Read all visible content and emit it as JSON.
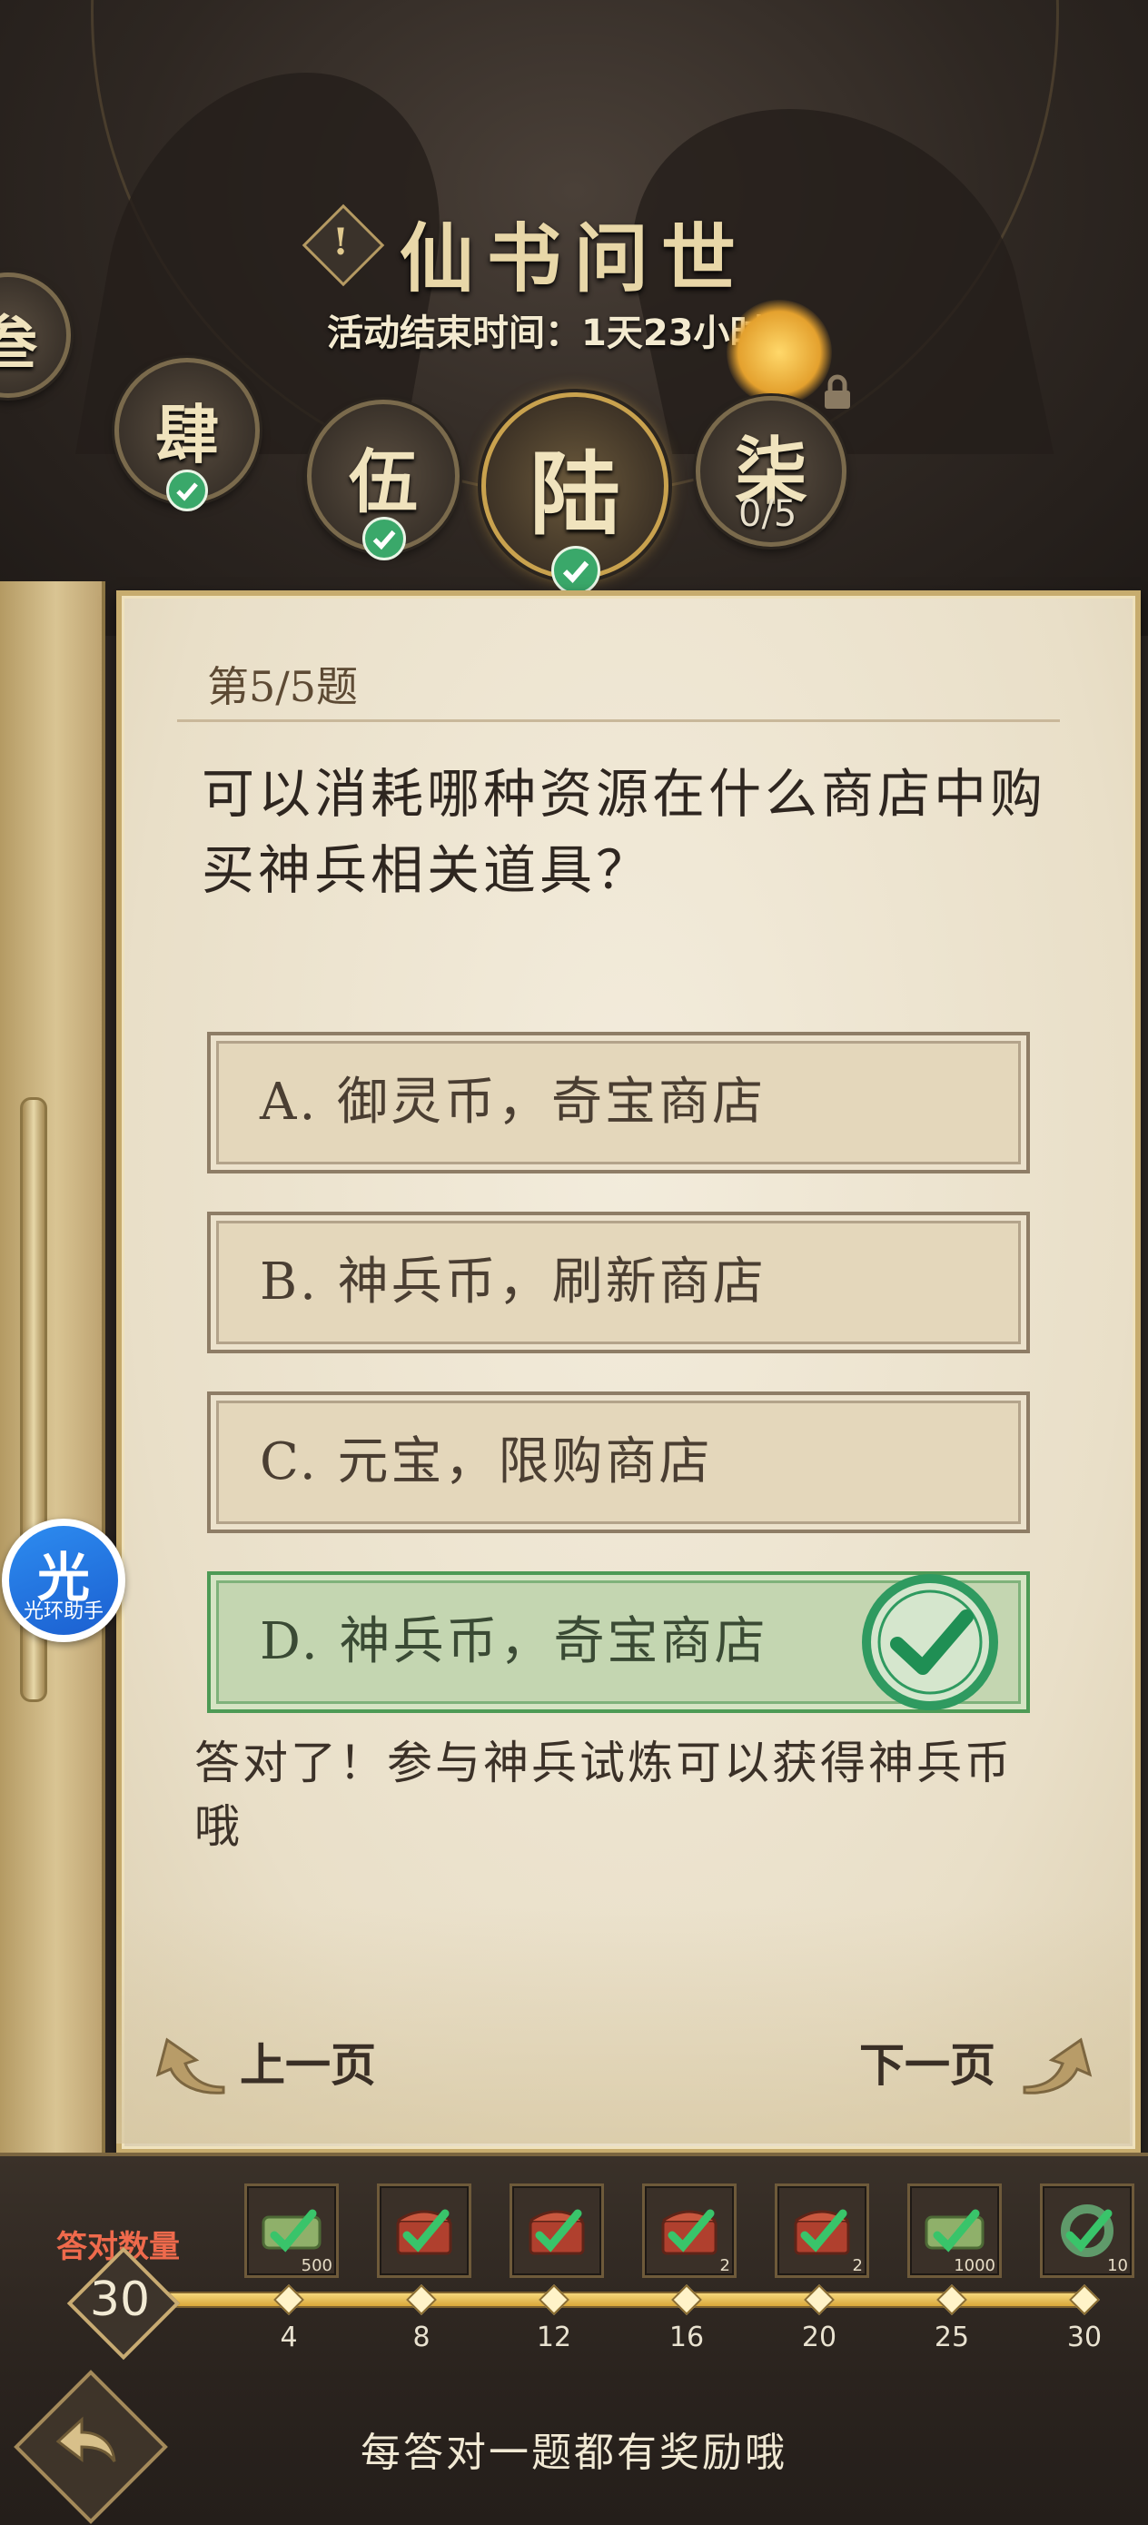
{
  "header": {
    "title": "仙书问世",
    "info_mark": "!",
    "end_time": "活动结束时间：1天23小时"
  },
  "chapters": [
    {
      "glyph": "叁",
      "state": "completed"
    },
    {
      "glyph": "肆",
      "state": "completed"
    },
    {
      "glyph": "伍",
      "state": "completed"
    },
    {
      "glyph": "陆",
      "state": "current-completed"
    },
    {
      "glyph": "柒",
      "state": "locked",
      "progress": "0/5"
    }
  ],
  "quiz": {
    "number": "第5/5题",
    "question": "可以消耗哪种资源在什么商店中购买神兵相关道具？",
    "options": [
      {
        "label": "A. 御灵币，奇宝商店",
        "correct": false
      },
      {
        "label": "B. 神兵币，刷新商店",
        "correct": false
      },
      {
        "label": "C. 元宝，限购商店",
        "correct": false
      },
      {
        "label": "D. 神兵币，奇宝商店",
        "correct": true
      }
    ],
    "feedback": "答对了！参与神兵试炼可以获得神兵币哦",
    "prev_label": "上一页",
    "next_label": "下一页"
  },
  "assistant": {
    "glyph": "光",
    "label": "光环助手"
  },
  "rewards": {
    "answered_label": "答对数量",
    "answered_count": "30",
    "milestones": [
      "4",
      "8",
      "12",
      "16",
      "20",
      "25",
      "30"
    ],
    "items": [
      {
        "icon": "scroll-icon",
        "qty": "500",
        "claimed": true
      },
      {
        "icon": "chest-icon",
        "qty": "",
        "claimed": true
      },
      {
        "icon": "chest-icon",
        "qty": "",
        "claimed": true
      },
      {
        "icon": "chest-icon",
        "qty": "2",
        "claimed": true
      },
      {
        "icon": "chest-icon",
        "qty": "2",
        "claimed": true
      },
      {
        "icon": "scroll-icon",
        "qty": "1000",
        "claimed": true
      },
      {
        "icon": "jade-ring-icon",
        "qty": "10",
        "claimed": true
      }
    ],
    "footer_tip": "每答对一题都有奖励哦"
  },
  "colors": {
    "accent_gold": "#c9a24e",
    "correct_green": "#3aa86a",
    "paper": "#ece3cf"
  }
}
